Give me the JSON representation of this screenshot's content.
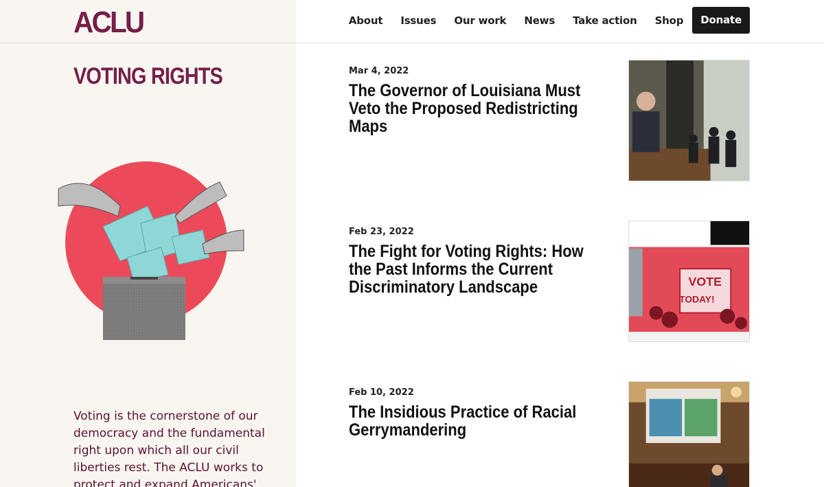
{
  "header": {
    "logo": "ACLU",
    "nav": [
      "About",
      "Issues",
      "Our work",
      "News",
      "Take action",
      "Shop"
    ],
    "donate": "Donate"
  },
  "page": {
    "title": "VOTING RIGHTS",
    "intro": "Voting is the cornerstone of our democracy and the fundamental right upon which all our civil liberties rest. The ACLU works to protect and expand Americans'"
  },
  "articles": [
    {
      "date": "Mar 4, 2022",
      "title": "The Governor of Louisiana Must Veto the Proposed Redistricting Maps",
      "image": "governor-podium-photo"
    },
    {
      "date": "Feb 23, 2022",
      "title": "The Fight for Voting Rights: How the Past Informs the Current Discriminatory Landscape",
      "image": "vote-today-protest-photo",
      "sign_text": [
        "VOTE",
        "TODAY!"
      ]
    },
    {
      "date": "Feb 10, 2022",
      "title": "The Insidious Practice of Racial Gerrymandering",
      "image": "redistricting-map-hearing-photo"
    }
  ],
  "colors": {
    "brand": "#741e48",
    "panel": "#f9f6f1",
    "accent_red": "#ec4a5a",
    "ballot_blue": "#8fd6d6"
  }
}
